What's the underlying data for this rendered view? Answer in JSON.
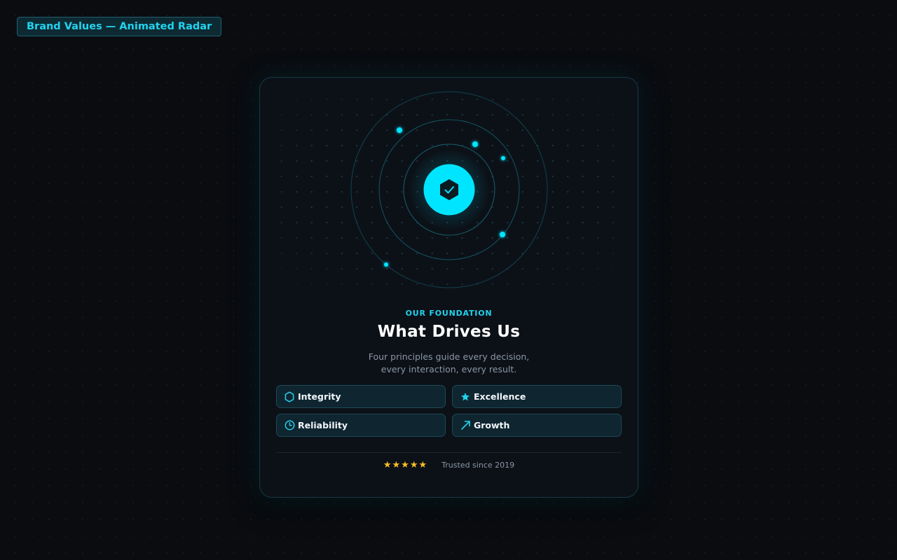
{
  "page": {
    "title_tag": "Brand Values — Animated Radar"
  },
  "card": {
    "eyebrow": "OUR FOUNDATION",
    "heading": "What Drives Us",
    "description_lines": [
      "Four principles guide every decision,",
      "every interaction, every result."
    ],
    "center_icon": "shield-check-icon",
    "values": [
      {
        "label": "Integrity",
        "icon": "hexagon-icon"
      },
      {
        "label": "Excellence",
        "icon": "star-icon"
      },
      {
        "label": "Reliability",
        "icon": "clock-icon"
      },
      {
        "label": "Growth",
        "icon": "arrow-up-right-icon"
      }
    ],
    "rating": {
      "stars": "★★★★★",
      "value": 5,
      "max": 5
    },
    "trusted_text": "Trusted since 2019"
  },
  "colors": {
    "accent": "#00e5ff",
    "accent_text": "#22d3ee",
    "background": "#0a0c10",
    "card": "#0c1118",
    "star": "#fbbf24"
  }
}
